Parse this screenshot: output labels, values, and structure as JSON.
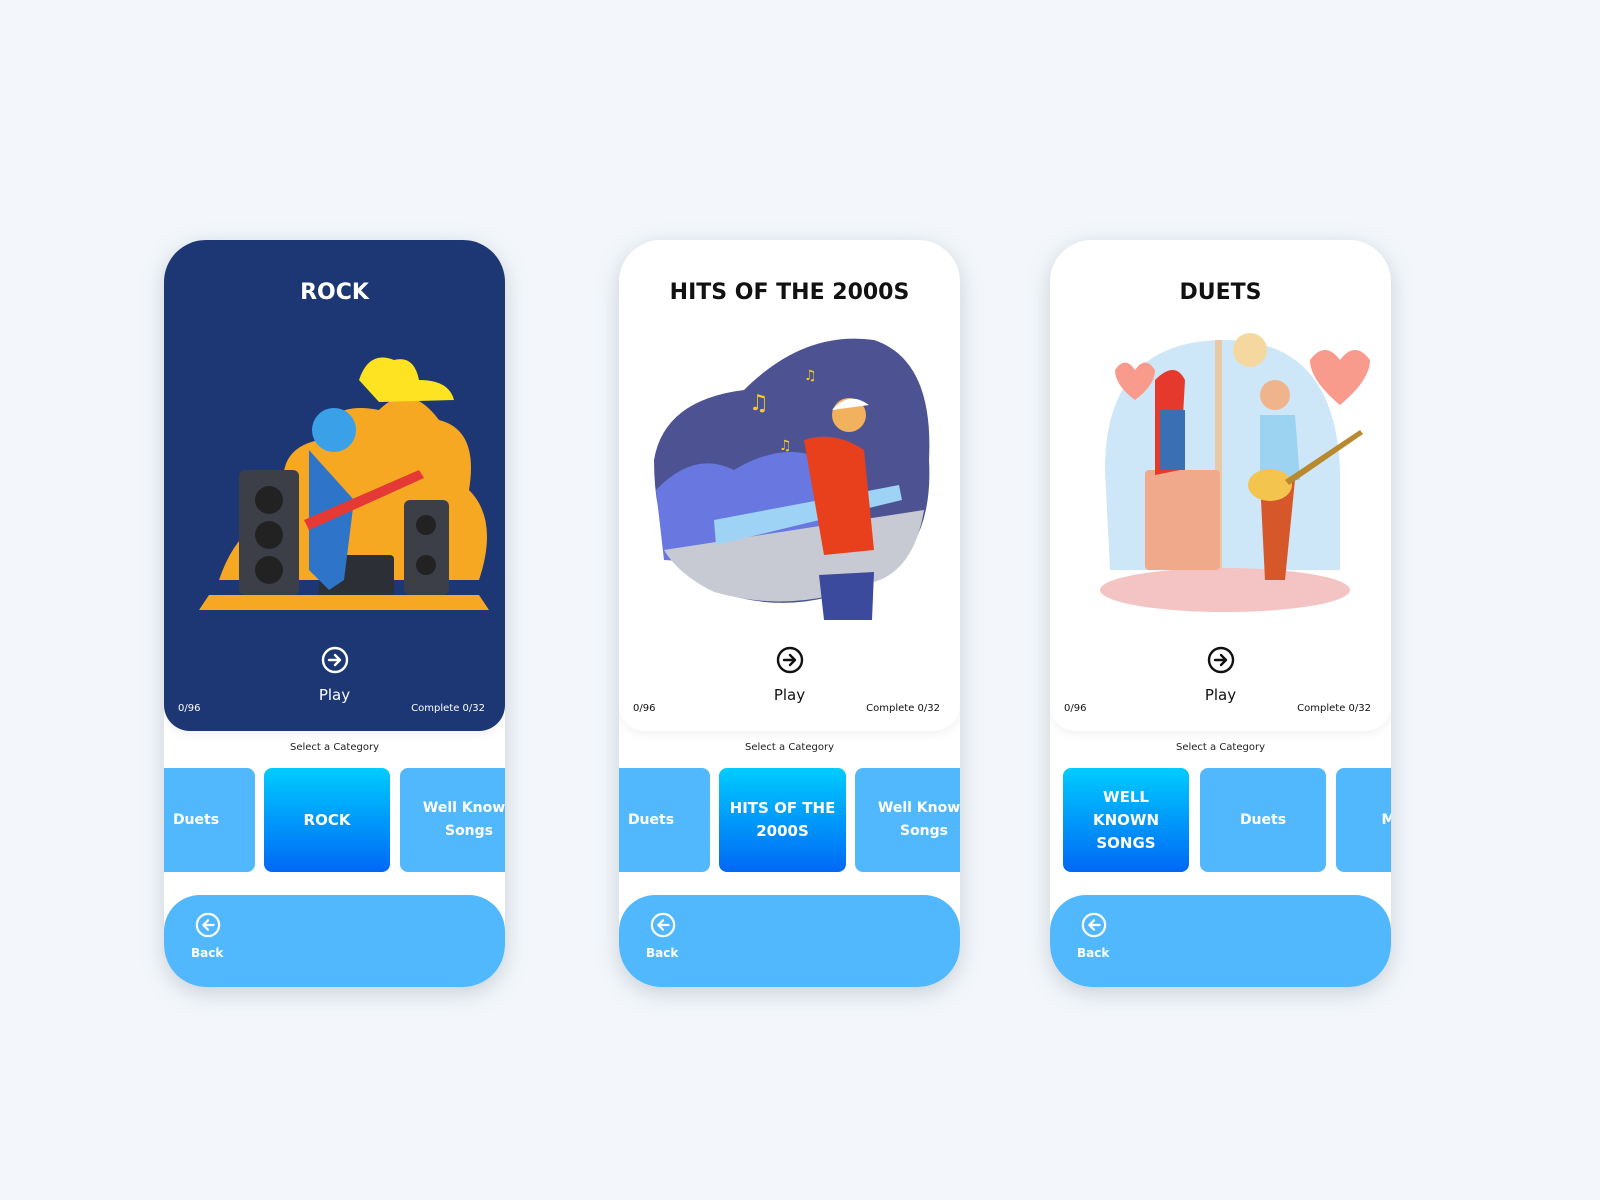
{
  "colors": {
    "dark_card": "#1c3774",
    "tile": "#52b8fd",
    "active_tile_top": "#00ccff",
    "active_tile_bottom": "#0068f5"
  },
  "screens": [
    {
      "title": "ROCK",
      "theme": "dark",
      "illustration": "rock-guitarist-illustration",
      "play_label": "Play",
      "progress": "0/96",
      "complete": "Complete 0/32",
      "select_label": "Select a Category",
      "categories": [
        {
          "label": "Duets",
          "active": false
        },
        {
          "label": "ROCK",
          "active": true
        },
        {
          "label": "Well Known Songs",
          "active": false
        }
      ],
      "back_label": "Back"
    },
    {
      "title": "HITS OF THE 2000S",
      "theme": "light",
      "illustration": "dj-party-illustration",
      "play_label": "Play",
      "progress": "0/96",
      "complete": "Complete 0/32",
      "select_label": "Select a Category",
      "categories": [
        {
          "label": "Duets",
          "active": false
        },
        {
          "label": "HITS OF THE 2000S",
          "active": true
        },
        {
          "label": "Well Known Songs",
          "active": false
        }
      ],
      "back_label": "Back"
    },
    {
      "title": "DUETS",
      "theme": "light",
      "illustration": "duet-couple-illustration",
      "play_label": "Play",
      "progress": "0/96",
      "complete": "Complete 0/32",
      "select_label": "Select a Category",
      "categories": [
        {
          "label": "WELL KNOWN SONGS",
          "active": true
        },
        {
          "label": "Duets",
          "active": false
        },
        {
          "label": "Movie",
          "active": false
        }
      ],
      "back_label": "Back"
    }
  ]
}
